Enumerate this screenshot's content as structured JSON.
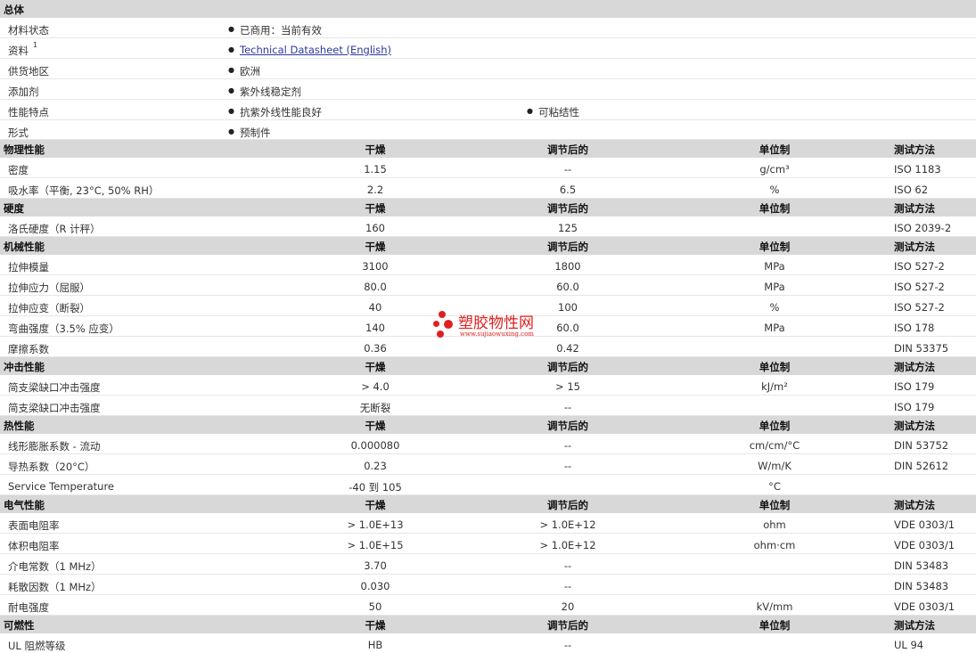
{
  "general": {
    "title": "总体",
    "rows": [
      {
        "label": "材料状态",
        "sup": "",
        "items": [
          "已商用：当前有效"
        ],
        "link": ""
      },
      {
        "label": "资料",
        "sup": "1",
        "items": [],
        "link": "Technical Datasheet (English)"
      },
      {
        "label": "供货地区",
        "sup": "",
        "items": [
          "欧洲"
        ],
        "link": ""
      },
      {
        "label": "添加剂",
        "sup": "",
        "items": [
          "紫外线稳定剂"
        ],
        "link": ""
      },
      {
        "label": "性能特点",
        "sup": "",
        "items": [
          "抗紫外线性能良好",
          "可粘结性"
        ],
        "link": ""
      },
      {
        "label": "形式",
        "sup": "",
        "items": [
          "预制件"
        ],
        "link": ""
      }
    ]
  },
  "sections": [
    {
      "title": "物理性能",
      "h1": "干燥",
      "h2": "调节后的",
      "h3": "单位制",
      "h4": "测试方法",
      "rows": [
        {
          "label": "密度",
          "v1": "1.15",
          "v2": "--",
          "unit": "g/cm³",
          "method": "ISO 1183"
        },
        {
          "label": "吸水率（平衡, 23°C, 50% RH）",
          "v1": "2.2",
          "v2": "6.5",
          "unit": "%",
          "method": "ISO 62"
        }
      ]
    },
    {
      "title": "硬度",
      "h1": "干燥",
      "h2": "调节后的",
      "h3": "单位制",
      "h4": "测试方法",
      "rows": [
        {
          "label": "洛氏硬度（R 计秤）",
          "v1": "160",
          "v2": "125",
          "unit": "",
          "method": "ISO 2039-2"
        }
      ]
    },
    {
      "title": "机械性能",
      "h1": "干燥",
      "h2": "调节后的",
      "h3": "单位制",
      "h4": "测试方法",
      "rows": [
        {
          "label": "拉伸模量",
          "v1": "3100",
          "v2": "1800",
          "unit": "MPa",
          "method": "ISO 527-2"
        },
        {
          "label": "拉伸应力（屈服）",
          "v1": "80.0",
          "v2": "60.0",
          "unit": "MPa",
          "method": "ISO 527-2"
        },
        {
          "label": "拉伸应变（断裂）",
          "v1": "40",
          "v2": "100",
          "unit": "%",
          "method": "ISO 527-2"
        },
        {
          "label": "弯曲强度（3.5% 应变）",
          "v1": "140",
          "v2": "60.0",
          "unit": "MPa",
          "method": "ISO 178"
        },
        {
          "label": "摩擦系数",
          "v1": "0.36",
          "v2": "0.42",
          "unit": "",
          "method": "DIN 53375"
        }
      ]
    },
    {
      "title": "冲击性能",
      "h1": "干燥",
      "h2": "调节后的",
      "h3": "单位制",
      "h4": "测试方法",
      "rows": [
        {
          "label": "简支梁缺口冲击强度",
          "v1": "> 4.0",
          "v2": "> 15",
          "unit": "kJ/m²",
          "method": "ISO 179"
        },
        {
          "label": "简支梁缺口冲击强度",
          "v1": "无断裂",
          "v2": "--",
          "unit": "",
          "method": "ISO 179"
        }
      ]
    },
    {
      "title": "热性能",
      "h1": "干燥",
      "h2": "调节后的",
      "h3": "单位制",
      "h4": "测试方法",
      "rows": [
        {
          "label": "线形膨胀系数 - 流动",
          "v1": "0.000080",
          "v2": "--",
          "unit": "cm/cm/°C",
          "method": "DIN 53752"
        },
        {
          "label": "导热系数（20°C）",
          "v1": "0.23",
          "v2": "--",
          "unit": "W/m/K",
          "method": "DIN 52612"
        },
        {
          "label": "Service Temperature",
          "v1": "-40 到 105",
          "v2": "",
          "unit": "°C",
          "method": ""
        }
      ]
    },
    {
      "title": "电气性能",
      "h1": "干燥",
      "h2": "调节后的",
      "h3": "单位制",
      "h4": "测试方法",
      "rows": [
        {
          "label": "表面电阻率",
          "v1": "> 1.0E+13",
          "v2": "> 1.0E+12",
          "unit": "ohm",
          "method": "VDE 0303/1"
        },
        {
          "label": "体积电阻率",
          "v1": "> 1.0E+15",
          "v2": "> 1.0E+12",
          "unit": "ohm·cm",
          "method": "VDE 0303/1"
        },
        {
          "label": "介电常数（1 MHz）",
          "v1": "3.70",
          "v2": "--",
          "unit": "",
          "method": "DIN 53483"
        },
        {
          "label": "耗散因数（1 MHz）",
          "v1": "0.030",
          "v2": "--",
          "unit": "",
          "method": "DIN 53483"
        },
        {
          "label": "耐电强度",
          "v1": "50",
          "v2": "20",
          "unit": "kV/mm",
          "method": "VDE 0303/1"
        }
      ]
    },
    {
      "title": "可燃性",
      "h1": "干燥",
      "h2": "调节后的",
      "h3": "单位制",
      "h4": "测试方法",
      "rows": [
        {
          "label": "UL 阻燃等级",
          "v1": "HB",
          "v2": "--",
          "unit": "",
          "method": "UL 94"
        }
      ]
    }
  ],
  "watermark": {
    "brand": "塑胶物性网",
    "url": "www.sujiaowuxing.com",
    "color": "#e02020"
  }
}
